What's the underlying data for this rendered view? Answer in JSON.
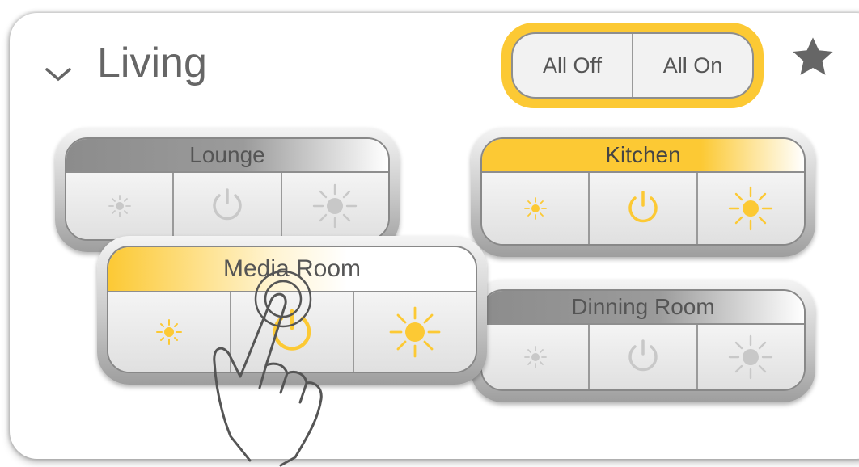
{
  "room": {
    "title": "Living"
  },
  "all_toggle": {
    "off_label": "All Off",
    "on_label": "All On"
  },
  "colors": {
    "accent": "#fcc934",
    "off_gray": "#9b9b9b"
  },
  "icons": [
    "chevron-down-icon",
    "star-icon",
    "dim-light-icon",
    "power-icon",
    "bright-light-icon",
    "tap-gesture-icon"
  ],
  "zones": [
    {
      "name": "Lounge",
      "state": "off"
    },
    {
      "name": "Kitchen",
      "state": "on"
    },
    {
      "name": "Media Room",
      "state": "on"
    },
    {
      "name": "Dinning Room",
      "state": "off"
    }
  ]
}
